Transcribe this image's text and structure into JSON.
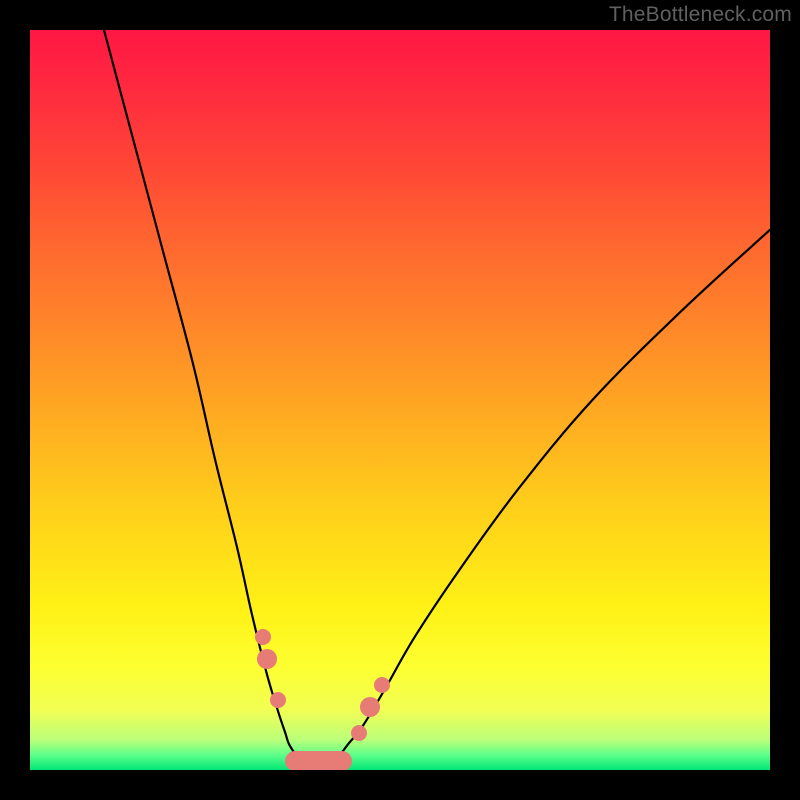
{
  "watermark": "TheBottleneck.com",
  "colors": {
    "gradient_top": "#ff1744",
    "gradient_mid": "#ffd31a",
    "gradient_bottom": "#00e676",
    "curve": "#000000",
    "beads": "#e77b76",
    "frame": "#000000"
  },
  "chart_data": {
    "type": "line",
    "title": "",
    "xlabel": "",
    "ylabel": "",
    "xlim": [
      0,
      100
    ],
    "ylim": [
      0,
      100
    ],
    "grid": false,
    "legend": false,
    "series": [
      {
        "name": "left-branch",
        "x": [
          10,
          14,
          18,
          22,
          25,
          28,
          30,
          32,
          33.5,
          34.5,
          35,
          36,
          37,
          38,
          39
        ],
        "y": [
          100,
          85,
          70,
          55,
          42,
          30,
          21,
          13,
          8,
          5,
          3.5,
          2,
          1,
          0.5,
          0
        ]
      },
      {
        "name": "right-branch",
        "x": [
          39,
          40,
          41,
          42,
          43,
          45,
          48,
          52,
          58,
          66,
          76,
          88,
          100
        ],
        "y": [
          0,
          0.5,
          1.2,
          2.2,
          3.5,
          6,
          11,
          18,
          27,
          38,
          50,
          62,
          73
        ]
      }
    ],
    "markers": [
      {
        "name": "l1",
        "x": 31.5,
        "y": 18.0,
        "r": 8
      },
      {
        "name": "l2",
        "x": 32.0,
        "y": 15.0,
        "r": 10
      },
      {
        "name": "l3",
        "x": 33.5,
        "y": 9.5,
        "r": 8
      },
      {
        "name": "r1",
        "x": 44.5,
        "y": 5.0,
        "r": 8
      },
      {
        "name": "r2",
        "x": 46.0,
        "y": 8.5,
        "r": 10
      },
      {
        "name": "r3",
        "x": 47.5,
        "y": 11.5,
        "r": 8
      }
    ],
    "floor": {
      "x_start": 34.5,
      "x_end": 43.5,
      "y": 1.2,
      "thickness_pct": 2.7
    }
  }
}
